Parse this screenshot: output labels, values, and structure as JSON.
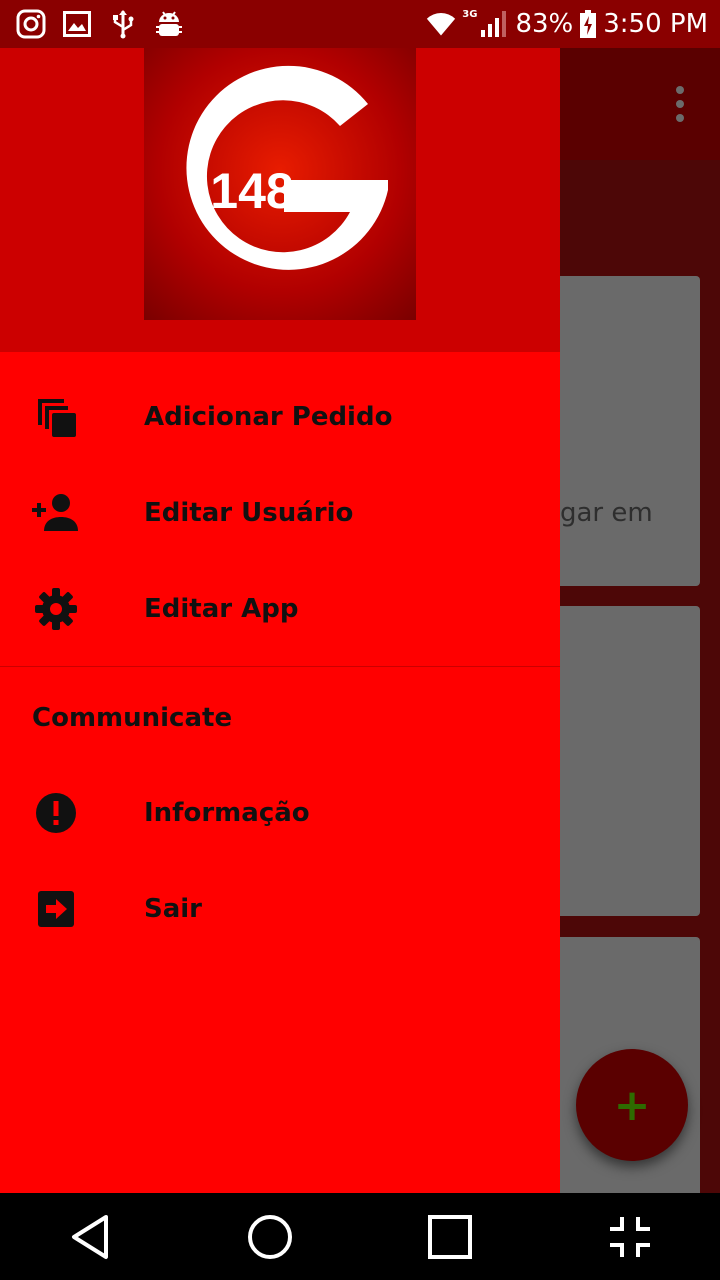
{
  "status_bar": {
    "network": "3G",
    "battery": "83%",
    "time": "3:50 PM",
    "icons": [
      "instagram-icon",
      "image-icon",
      "usb-icon",
      "android-debug-icon",
      "wifi-icon",
      "signal-icon",
      "battery-charging-icon"
    ]
  },
  "background": {
    "card_text": "gar em",
    "fab_label": "+"
  },
  "drawer": {
    "logo_text": "148",
    "logo_letter": "G",
    "items": [
      {
        "label": "Adicionar Pedido",
        "icon": "copy-icon"
      },
      {
        "label": "Editar Usuário",
        "icon": "person-add-icon"
      },
      {
        "label": "Editar App",
        "icon": "gear-icon"
      }
    ],
    "section_title": "Communicate",
    "section_items": [
      {
        "label": "Informação",
        "icon": "info-alert-icon"
      },
      {
        "label": "Sair",
        "icon": "exit-icon"
      }
    ]
  },
  "colors": {
    "status_bar": "#8a0000",
    "drawer_bg": "#ff0000",
    "drawer_header": "#cc0000",
    "nav_bar": "#000000"
  }
}
